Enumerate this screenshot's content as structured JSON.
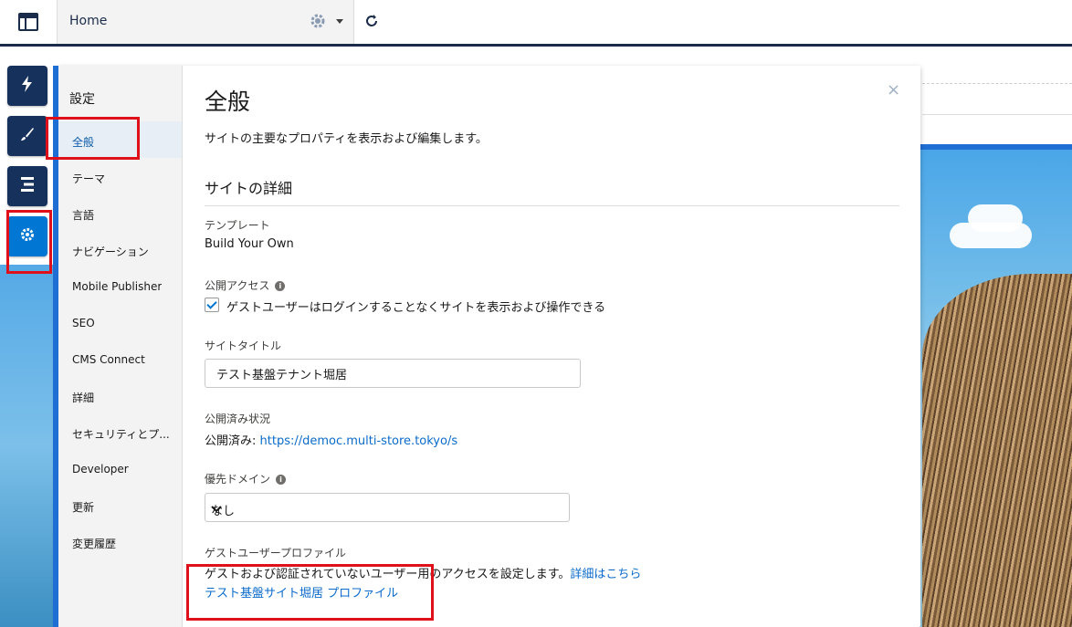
{
  "topbar": {
    "home_label": "Home"
  },
  "colors": {
    "accent": "#0176d3",
    "nav_dark": "#16325c",
    "highlight": "#e0101b",
    "link": "#0b6bcb"
  },
  "rail": [
    {
      "icon": "lightning-icon"
    },
    {
      "icon": "brush-icon"
    },
    {
      "icon": "list-icon"
    },
    {
      "icon": "gear-icon",
      "active": true
    }
  ],
  "sidebar": {
    "title": "設定",
    "items": [
      {
        "label": "全般",
        "selected": true
      },
      {
        "label": "テーマ"
      },
      {
        "label": "言語"
      },
      {
        "label": "ナビゲーション"
      },
      {
        "label": "Mobile Publisher"
      },
      {
        "label": "SEO"
      },
      {
        "label": "CMS Connect"
      },
      {
        "label": "詳細"
      },
      {
        "label": "セキュリティとプ..."
      },
      {
        "label": "Developer"
      },
      {
        "label": "更新"
      },
      {
        "label": "変更履歴"
      }
    ]
  },
  "main": {
    "title": "全般",
    "close": "×",
    "description": "サイトの主要なプロパティを表示および編集します。",
    "section_title": "サイトの詳細",
    "template": {
      "label": "テンプレート",
      "value": "Build Your Own"
    },
    "public_access": {
      "label": "公開アクセス",
      "checkbox_label": "ゲストユーザーはログインすることなくサイトを表示および操作できる"
    },
    "site_title": {
      "label": "サイトタイトル",
      "value": "テスト基盤テナント堀居"
    },
    "publish_status": {
      "label": "公開済み状況",
      "prefix": "公開済み: ",
      "url": "https://democ.multi-store.tokyo/s"
    },
    "preferred_domain": {
      "label": "優先ドメイン",
      "selected": "なし"
    },
    "guest_profile": {
      "label": "ゲストユーザープロファイル",
      "desc": "ゲストおよび認証されていないユーザー用のアクセスを設定します。",
      "detail_link": "詳細はこちら",
      "profile_link": "テスト基盤サイト堀居 プロファイル"
    }
  }
}
